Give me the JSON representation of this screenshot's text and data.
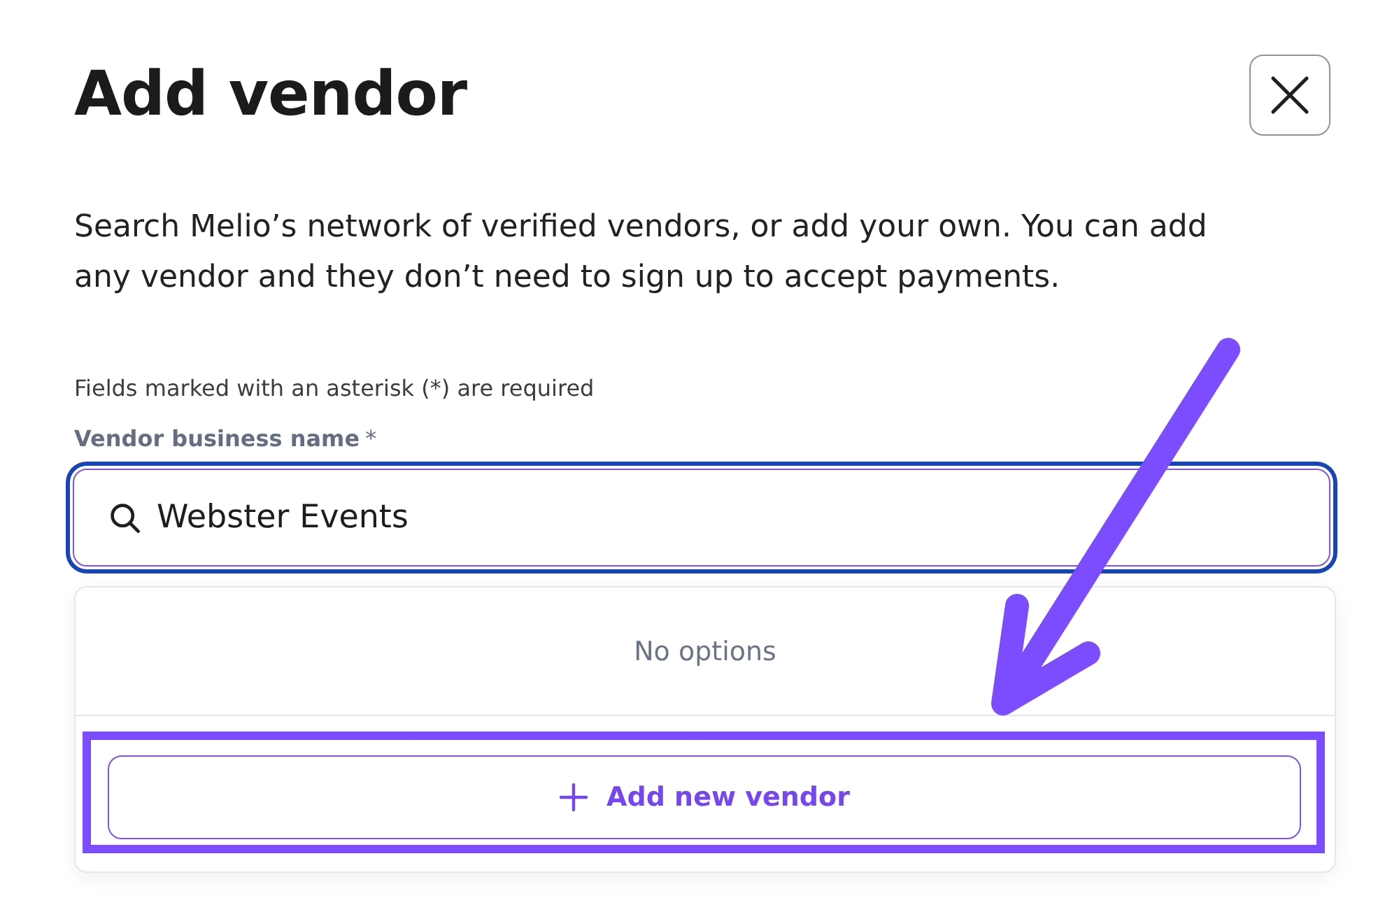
{
  "dialog": {
    "title": "Add vendor",
    "description": "Search Melio’s network of verified vendors, or add your own. You can add any vendor and they don’t need to sign up to accept payments.",
    "required_note": "Fields marked with an asterisk (*) are required"
  },
  "vendor_field": {
    "label": "Vendor business name",
    "required_mark": "*",
    "value": "Webster Events",
    "focused": true
  },
  "dropdown": {
    "empty_message": "No options",
    "action": {
      "label": "Add new vendor",
      "highlighted": true
    }
  },
  "annotations": [
    {
      "kind": "arrow"
    }
  ]
}
